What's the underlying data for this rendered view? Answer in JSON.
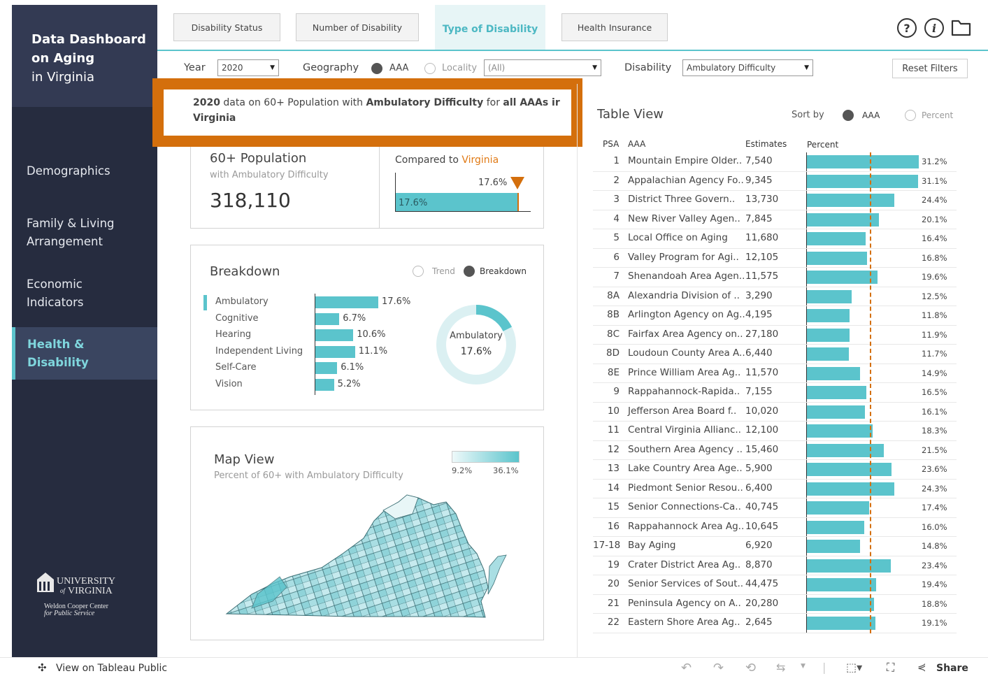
{
  "sidebar": {
    "title_line1": "Data Dashboard",
    "title_line2": "on Aging",
    "title_line3": "in Virginia",
    "nav": [
      {
        "label": "Demographics"
      },
      {
        "label": "Family & Living\nArrangement"
      },
      {
        "label": "Economic\nIndicators"
      },
      {
        "label": "Health &\nDisability"
      }
    ],
    "logo_name": "University of Virginia",
    "logo_line1": "UNIVERSITY",
    "logo_line2": "VIRGINIA",
    "logo_of": "of",
    "logo_center1": "Weldon Cooper Center",
    "logo_center2": "for Public Service"
  },
  "tabs": [
    {
      "label": "Disability Status"
    },
    {
      "label": "Number of Disability"
    },
    {
      "label": "Type of Disability"
    },
    {
      "label": "Health Insurance"
    }
  ],
  "toolbar_icons": [
    "help-icon",
    "info-icon",
    "folder-icon"
  ],
  "filters": {
    "year_label": "Year",
    "year_value": "2020",
    "geography_label": "Geography",
    "geo_option_aaa": "AAA",
    "geo_option_locality": "Locality",
    "locality_value": "(All)",
    "disability_label": "Disability",
    "disability_value": "Ambulatory Difficulty",
    "reset_label": "Reset Filters"
  },
  "headline": {
    "year": "2020",
    "t1": " data on 60+ Population with ",
    "topic": "Ambulatory Difficulty",
    "t2": " for ",
    "scope": "all AAAs ir",
    "line2": "Virginia"
  },
  "kpi": {
    "title": "60+ Population",
    "subtitle": "with Ambulatory Difficulty",
    "value": "318,110",
    "compare_label": "Compared to ",
    "compare_target": "Virginia",
    "bar_value": "17.6%",
    "marker_value": "17.6%",
    "bar_fraction": 1.0
  },
  "breakdown": {
    "title": "Breakdown",
    "toggle_trend": "Trend",
    "toggle_breakdown": "Breakdown",
    "items": [
      {
        "label": "Ambulatory",
        "value": "17.6%",
        "pct": 17.6
      },
      {
        "label": "Cognitive",
        "value": "6.7%",
        "pct": 6.7
      },
      {
        "label": "Hearing",
        "value": "10.6%",
        "pct": 10.6
      },
      {
        "label": "Independent Living",
        "value": "11.1%",
        "pct": 11.1
      },
      {
        "label": "Self-Care",
        "value": "6.1%",
        "pct": 6.1
      },
      {
        "label": "Vision",
        "value": "5.2%",
        "pct": 5.2
      }
    ],
    "donut_label": "Ambulatory",
    "donut_value": "17.6%",
    "donut_pct": 17.6
  },
  "map": {
    "title": "Map View",
    "subtitle": "Percent of 60+ with Ambulatory Difficulty",
    "legend_min": "9.2%",
    "legend_max": "36.1%"
  },
  "table": {
    "title": "Table View",
    "sort_label": "Sort by",
    "sort_aaa": "AAA",
    "sort_percent": "Percent",
    "col_psa": "PSA",
    "col_aaa": "AAA",
    "col_est": "Estimates",
    "col_pct": "Percent",
    "reference_pct": 17.6,
    "rows": [
      {
        "psa": "1",
        "aaa": "Mountain Empire Older..",
        "est": "7,540",
        "pct": "31.2%",
        "v": 31.2
      },
      {
        "psa": "2",
        "aaa": "Appalachian Agency Fo..",
        "est": "9,345",
        "pct": "31.1%",
        "v": 31.1
      },
      {
        "psa": "3",
        "aaa": "District Three Govern..",
        "est": "13,730",
        "pct": "24.4%",
        "v": 24.4
      },
      {
        "psa": "4",
        "aaa": "New River Valley Agen..",
        "est": "7,845",
        "pct": "20.1%",
        "v": 20.1
      },
      {
        "psa": "5",
        "aaa": "Local Office on Aging",
        "est": "11,680",
        "pct": "16.4%",
        "v": 16.4
      },
      {
        "psa": "6",
        "aaa": "Valley Program for Agi..",
        "est": "12,105",
        "pct": "16.8%",
        "v": 16.8
      },
      {
        "psa": "7",
        "aaa": "Shenandoah Area Agen..",
        "est": "11,575",
        "pct": "19.6%",
        "v": 19.6
      },
      {
        "psa": "8A",
        "aaa": "Alexandria Division of ..",
        "est": "3,290",
        "pct": "12.5%",
        "v": 12.5
      },
      {
        "psa": "8B",
        "aaa": "Arlington Agency on Ag..",
        "est": "4,195",
        "pct": "11.8%",
        "v": 11.8
      },
      {
        "psa": "8C",
        "aaa": "Fairfax Area Agency on..",
        "est": "27,180",
        "pct": "11.9%",
        "v": 11.9
      },
      {
        "psa": "8D",
        "aaa": "Loudoun County Area A..",
        "est": "6,440",
        "pct": "11.7%",
        "v": 11.7
      },
      {
        "psa": "8E",
        "aaa": "Prince William Area Ag..",
        "est": "11,570",
        "pct": "14.9%",
        "v": 14.9
      },
      {
        "psa": "9",
        "aaa": "Rappahannock-Rapida..",
        "est": "7,155",
        "pct": "16.5%",
        "v": 16.5
      },
      {
        "psa": "10",
        "aaa": "Jefferson Area Board f..",
        "est": "10,020",
        "pct": "16.1%",
        "v": 16.1
      },
      {
        "psa": "11",
        "aaa": "Central Virginia Allianc..",
        "est": "12,100",
        "pct": "18.3%",
        "v": 18.3
      },
      {
        "psa": "12",
        "aaa": "Southern Area Agency ..",
        "est": "15,460",
        "pct": "21.5%",
        "v": 21.5
      },
      {
        "psa": "13",
        "aaa": "Lake Country Area Age..",
        "est": "5,900",
        "pct": "23.6%",
        "v": 23.6
      },
      {
        "psa": "14",
        "aaa": "Piedmont Senior Resou..",
        "est": "6,400",
        "pct": "24.3%",
        "v": 24.3
      },
      {
        "psa": "15",
        "aaa": "Senior Connections-Ca..",
        "est": "40,745",
        "pct": "17.4%",
        "v": 17.4
      },
      {
        "psa": "16",
        "aaa": "Rappahannock Area Ag..",
        "est": "10,645",
        "pct": "16.0%",
        "v": 16.0
      },
      {
        "psa": "17-18",
        "aaa": "Bay Aging",
        "est": "6,920",
        "pct": "14.8%",
        "v": 14.8
      },
      {
        "psa": "19",
        "aaa": "Crater District Area Ag..",
        "est": "8,870",
        "pct": "23.4%",
        "v": 23.4
      },
      {
        "psa": "20",
        "aaa": "Senior Services of Sout..",
        "est": "44,475",
        "pct": "19.4%",
        "v": 19.4
      },
      {
        "psa": "21",
        "aaa": "Peninsula Agency on A..",
        "est": "20,280",
        "pct": "18.8%",
        "v": 18.8
      },
      {
        "psa": "22",
        "aaa": "Eastern Shore Area Ag..",
        "est": "2,645",
        "pct": "19.1%",
        "v": 19.1
      }
    ]
  },
  "bottom": {
    "view_label": "View on Tableau Public",
    "share_label": "Share"
  },
  "colors": {
    "accent": "#5bc4cc",
    "orange": "#d46f0c",
    "sidebar": "#262c3f"
  }
}
